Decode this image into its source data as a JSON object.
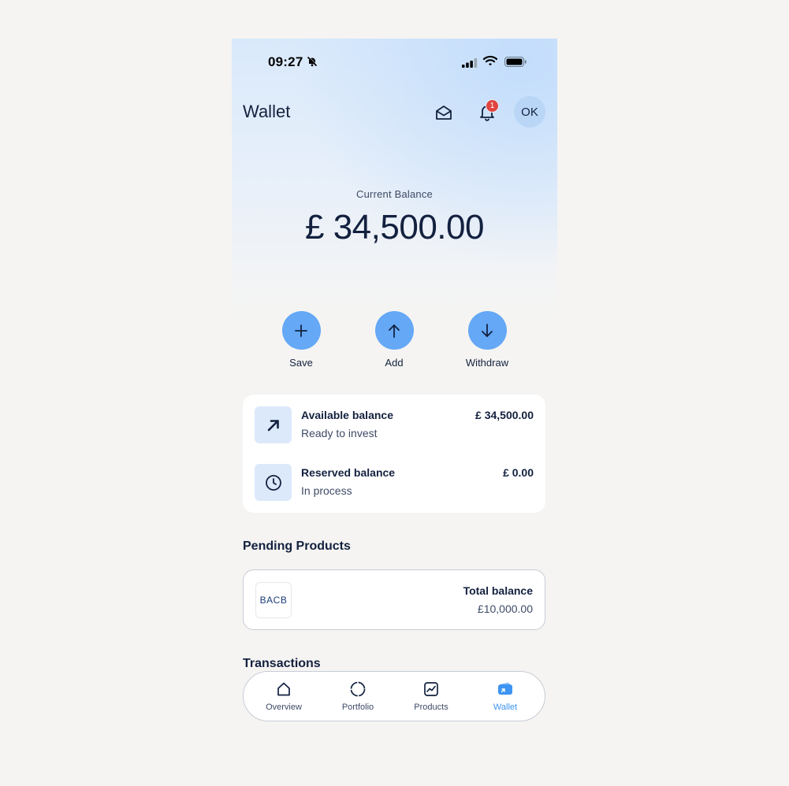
{
  "status_bar": {
    "time": "09:27",
    "icons": [
      "bell-slash-icon",
      "signal-icon",
      "wifi-icon",
      "battery-icon"
    ]
  },
  "header": {
    "title": "Wallet",
    "notification_count": "1",
    "avatar_initials": "OK",
    "icons": [
      "mail-open-icon",
      "bell-icon"
    ]
  },
  "balance": {
    "label": "Current Balance",
    "amount": "£ 34,500.00"
  },
  "actions": [
    {
      "label": "Save",
      "icon": "plus-icon"
    },
    {
      "label": "Add",
      "icon": "arrow-up-icon"
    },
    {
      "label": "Withdraw",
      "icon": "arrow-down-icon"
    }
  ],
  "balances": [
    {
      "title": "Available balance",
      "subtitle": "Ready to invest",
      "value": "£ 34,500.00",
      "icon": "arrow-up-right-icon"
    },
    {
      "title": "Reserved balance",
      "subtitle": "In process",
      "value": "£ 0.00",
      "icon": "clock-icon"
    }
  ],
  "pending": {
    "title": "Pending Products",
    "product": {
      "logo_text": "BACB",
      "label": "Total balance",
      "value": "£10,000.00"
    }
  },
  "transactions": {
    "title": "Transactions"
  },
  "nav": {
    "active": "Wallet",
    "accent_color": "#3d94f2",
    "items": [
      {
        "label": "Overview",
        "icon": "home-icon"
      },
      {
        "label": "Portfolio",
        "icon": "pie-chart-icon"
      },
      {
        "label": "Products",
        "icon": "chart-line-icon"
      },
      {
        "label": "Wallet",
        "icon": "wallet-icon"
      }
    ]
  },
  "colors": {
    "primary_text": "#13213f",
    "action_blue": "#64a8f6",
    "badge_red": "#e0443e",
    "icon_tile": "#dce9fa"
  }
}
